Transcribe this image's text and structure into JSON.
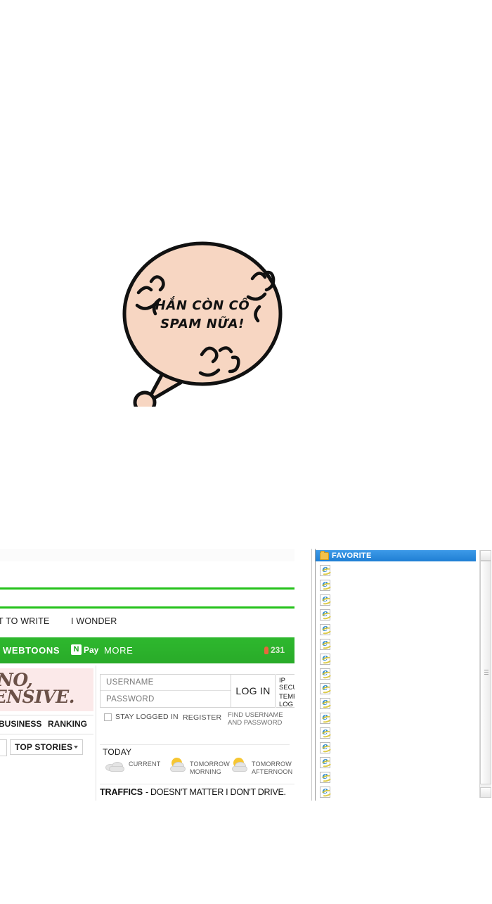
{
  "speech_bubble": {
    "text": "HẮN CÒN CỐ\nSPAM NỮA!"
  },
  "portal": {
    "quick_links": [
      {
        "label": "...T TO WRITE"
      },
      {
        "label": "I WONDER"
      }
    ],
    "green_nav": {
      "webtoons_label": "WEBTOONS",
      "npay_mark": "N",
      "npay_label": "Pay",
      "more_label": "MORE",
      "counter_value": "231",
      "counter_icon": "location-pin-icon",
      "background_color": "#2bb32b"
    },
    "promo_banner": {
      "line1": "NO,",
      "line2": "...ENSIVE.",
      "background_color": "#fbe9e9",
      "text_color": "#6b5148"
    },
    "news_tabs": [
      {
        "label": "BUSINESS"
      },
      {
        "label": "RANKING"
      }
    ],
    "stories_select": {
      "value": "TOP STORIES",
      "caret": "chevron-down-icon"
    },
    "login": {
      "username_placeholder": "USERNAME",
      "password_placeholder": "PASSWORD",
      "username_value": "",
      "password_value": "",
      "login_button_label": "LOG IN",
      "ip_security_label": "IP\nSECURITY",
      "ip_security_state": "ON",
      "temporary_login_label": "TEMPORARY\nLOG IN",
      "stay_logged_in_label": "STAY LOGGED IN",
      "stay_logged_in_checked": false,
      "register_label": "REGISTER",
      "find_credentials_label": "FIND USERNAME\nAND PASSWORD"
    },
    "today": {
      "heading": "TODAY",
      "forecasts": [
        {
          "caption": "CURRENT",
          "icon": "cloud-icon"
        },
        {
          "caption": "TOMORROW\nMORNING",
          "icon": "sun-behind-cloud-icon"
        },
        {
          "caption": "TOMORROW\nAFTERNOON",
          "icon": "sun-behind-cloud-icon"
        }
      ]
    },
    "traffic": {
      "heading": "TRAFFICS",
      "text": "- DOESN'T MATTER I DON'T DRIVE."
    }
  },
  "favorites_window": {
    "header": {
      "label": "FAVORITE",
      "icon": "folder-icon",
      "highlight_color": "#2f8fe0"
    },
    "items": [
      {
        "icon": "ie-shortcut-icon",
        "label": ""
      },
      {
        "icon": "ie-shortcut-icon",
        "label": ""
      },
      {
        "icon": "ie-shortcut-icon",
        "label": ""
      },
      {
        "icon": "ie-shortcut-icon",
        "label": ""
      },
      {
        "icon": "ie-shortcut-icon",
        "label": ""
      },
      {
        "icon": "ie-shortcut-icon",
        "label": ""
      },
      {
        "icon": "ie-shortcut-icon",
        "label": ""
      },
      {
        "icon": "ie-shortcut-icon",
        "label": ""
      },
      {
        "icon": "ie-shortcut-icon",
        "label": ""
      },
      {
        "icon": "ie-shortcut-icon",
        "label": ""
      },
      {
        "icon": "ie-shortcut-icon",
        "label": ""
      },
      {
        "icon": "ie-shortcut-icon",
        "label": ""
      },
      {
        "icon": "ie-shortcut-icon",
        "label": ""
      },
      {
        "icon": "ie-shortcut-icon",
        "label": ""
      },
      {
        "icon": "ie-shortcut-icon",
        "label": ""
      },
      {
        "icon": "ie-shortcut-icon",
        "label": ""
      }
    ],
    "scrollbar": {
      "up_arrow": "scroll-up-icon",
      "down_arrow": "scroll-down-icon"
    }
  }
}
